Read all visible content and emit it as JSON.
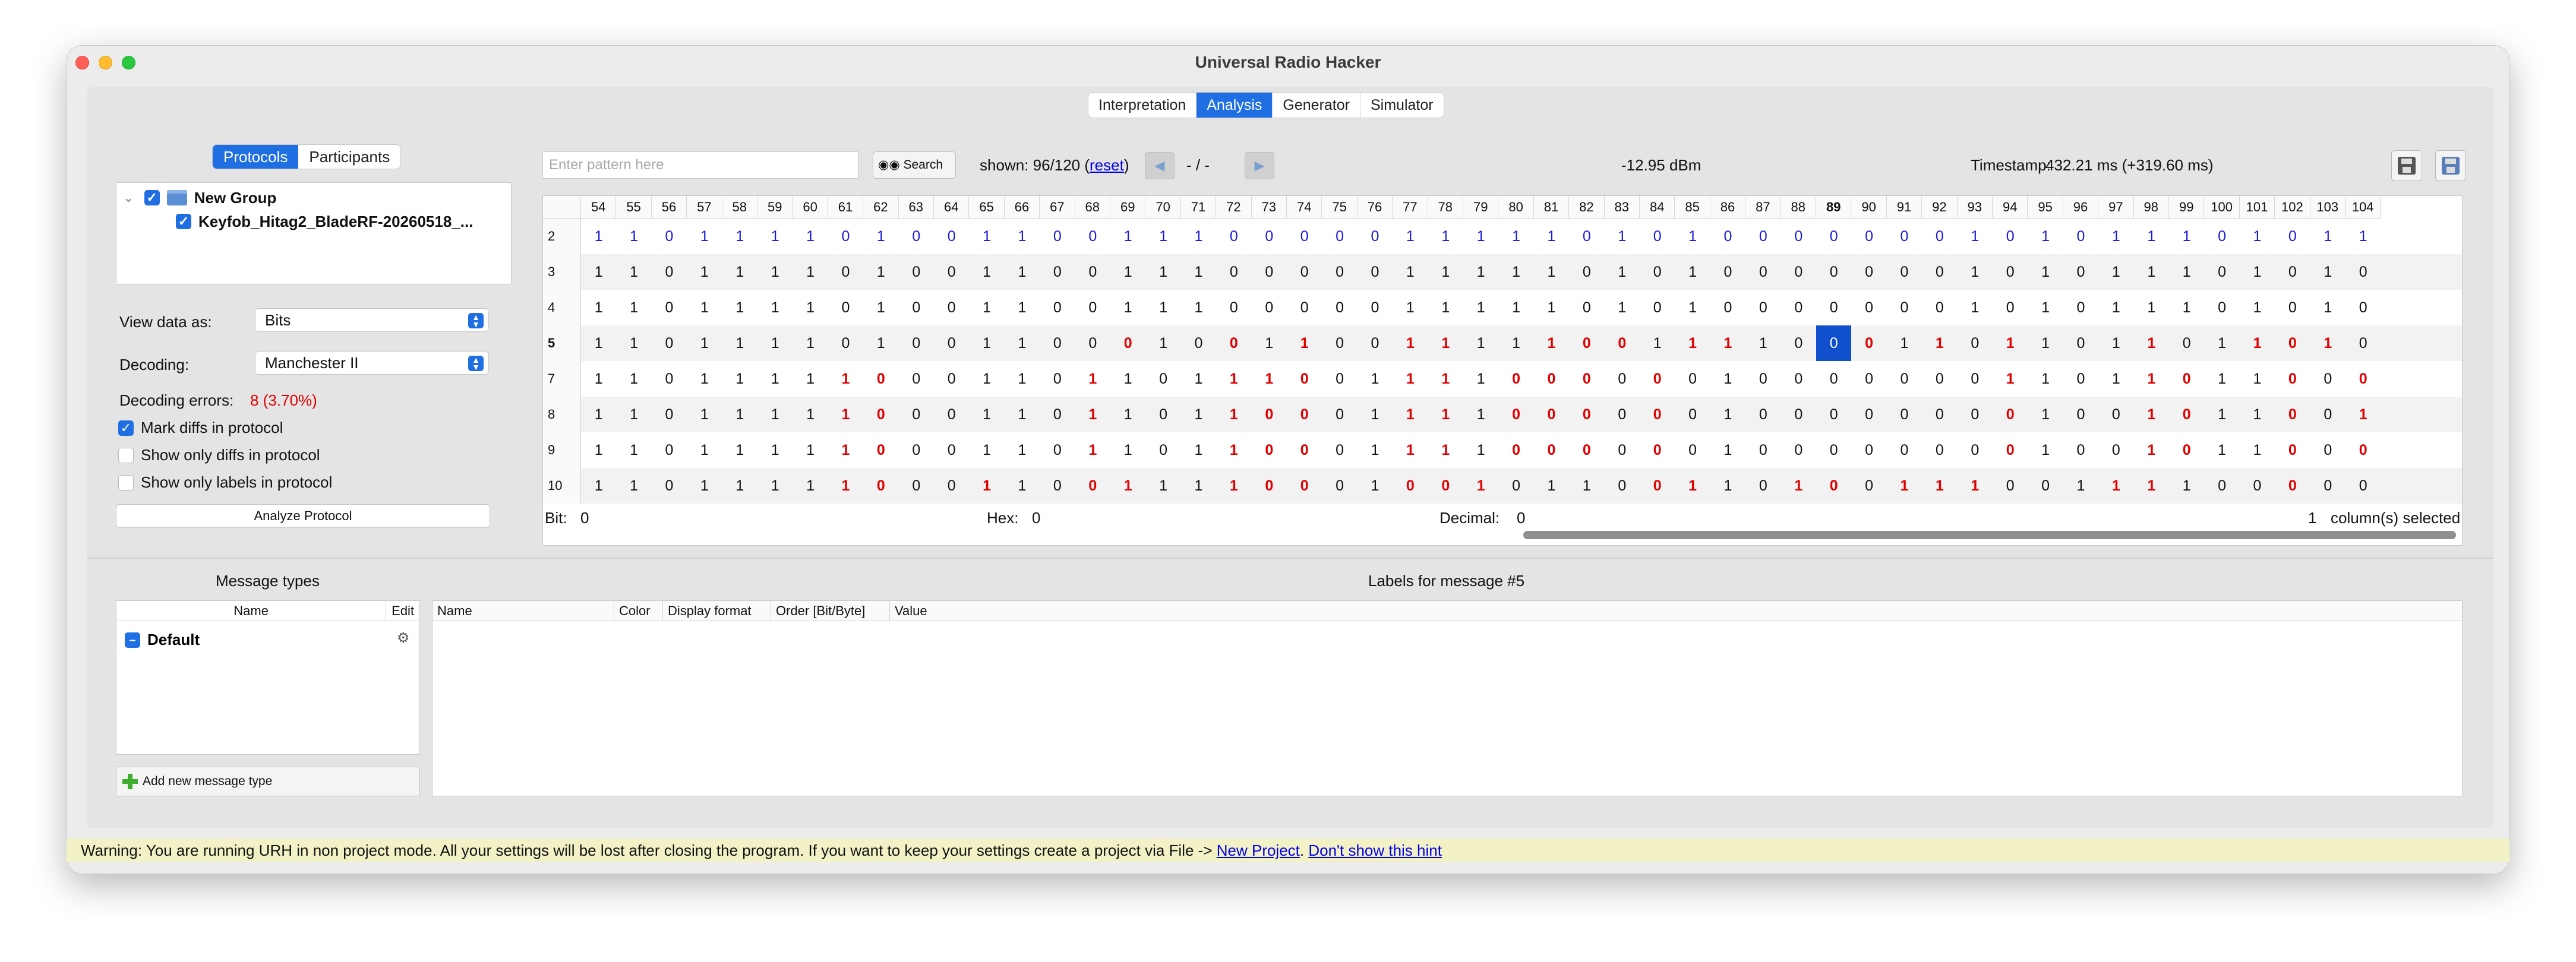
{
  "window": {
    "title": "Universal Radio Hacker"
  },
  "main_tabs": [
    "Interpretation",
    "Analysis",
    "Generator",
    "Simulator"
  ],
  "protocol_tabs": [
    "Protocols",
    "Participants"
  ],
  "tree": {
    "group": "New Group",
    "file": "Keyfob_Hitag2_BladeRF-20260518_..."
  },
  "view": {
    "label": "View data as:",
    "value": "Bits"
  },
  "decoding": {
    "label": "Decoding:",
    "value": "Manchester II"
  },
  "decoding_errors": {
    "label": "Decoding errors:",
    "value": "8 (3.70%)"
  },
  "checks": [
    {
      "label": "Mark diffs in protocol",
      "checked": true
    },
    {
      "label": "Show only diffs in protocol",
      "checked": false
    },
    {
      "label": "Show only labels in protocol",
      "checked": false
    }
  ],
  "analyze_btn": "Analyze Protocol",
  "search": {
    "placeholder": "Enter pattern here",
    "button": "Search",
    "shown": "shown: 96/120 (",
    "reset": "reset",
    "shown_end": ")",
    "nav": "-  /  -"
  },
  "signal": {
    "rssi": "-12.95 dBm",
    "timestamp_label": "Timestamp:",
    "timestamp": "432.21 ms (+319.60 ms)"
  },
  "status": {
    "bit_label": "Bit:",
    "bit": "0",
    "hex_label": "Hex:",
    "hex": "0",
    "dec_label": "Decimal:",
    "dec": "0",
    "cols": "1",
    "cols_label": "column(s) selected"
  },
  "table": {
    "columns": [
      "54",
      "55",
      "56",
      "57",
      "58",
      "59",
      "60",
      "61",
      "62",
      "63",
      "64",
      "65",
      "66",
      "67",
      "68",
      "69",
      "70",
      "71",
      "72",
      "73",
      "74",
      "75",
      "76",
      "77",
      "78",
      "79",
      "80",
      "81",
      "82",
      "83",
      "84",
      "85",
      "86",
      "87",
      "88",
      "89",
      "90",
      "91",
      "92",
      "93",
      "94",
      "95",
      "96",
      "97",
      "98",
      "99",
      "100",
      "101",
      "102",
      "103",
      "104"
    ],
    "selected_col": 35,
    "rows": [
      {
        "id": "2",
        "bits": "110111101001100111000001111101010000000101011101011",
        "diffs": [],
        "blue": true
      },
      {
        "id": "3",
        "bits": "110111101001100111000001111101010000000101011101010",
        "diffs": []
      },
      {
        "id": "4",
        "bits": "110111101001100111000001111101010000000101011101010",
        "diffs": []
      },
      {
        "id": "5",
        "bits": "110111101001100010011001111100111100011011011011010",
        "diffs": [
          15,
          18,
          20,
          23,
          24,
          27,
          28,
          29,
          31,
          32,
          36,
          38,
          40,
          44,
          47,
          48,
          49
        ],
        "sel": 35
      },
      {
        "id": "7",
        "bits": "110111110001101101110011110000001000000011011011000",
        "diffs": [
          7,
          8,
          14,
          18,
          19,
          20,
          23,
          24,
          26,
          27,
          28,
          30,
          40,
          44,
          45,
          48,
          50
        ]
      },
      {
        "id": "8",
        "bits": "110111110001101101100011110000001000000001001011001",
        "diffs": [
          7,
          8,
          14,
          18,
          19,
          20,
          23,
          24,
          26,
          27,
          28,
          30,
          40,
          44,
          45,
          48,
          50
        ]
      },
      {
        "id": "9",
        "bits": "110111110001101101100011110000001000000001001011000",
        "diffs": [
          7,
          8,
          14,
          18,
          19,
          20,
          23,
          24,
          26,
          27,
          28,
          30,
          40,
          44,
          45,
          48,
          50
        ]
      },
      {
        "id": "10",
        "bits": "110111110001100111100010010110011010011100111100000",
        "diffs": [
          7,
          8,
          11,
          14,
          15,
          18,
          19,
          20,
          23,
          24,
          25,
          30,
          31,
          34,
          35,
          37,
          38,
          39,
          43,
          44,
          48
        ]
      }
    ]
  },
  "message_types": {
    "title": "Message types",
    "col_name": "Name",
    "col_edit": "Edit",
    "items": [
      "Default"
    ],
    "add": "Add new message type"
  },
  "labels": {
    "title": "Labels for message #5",
    "cols": [
      "Name",
      "Color",
      "Display format",
      "Order [Bit/Byte]",
      "Value"
    ]
  },
  "warning": {
    "text": "Warning: You are running URH in non project mode. All your settings will be lost after closing the program. If you want to keep your settings create a project via File -> ",
    "link1": "New Project",
    "sep": ". ",
    "link2": "Don't show this hint"
  }
}
